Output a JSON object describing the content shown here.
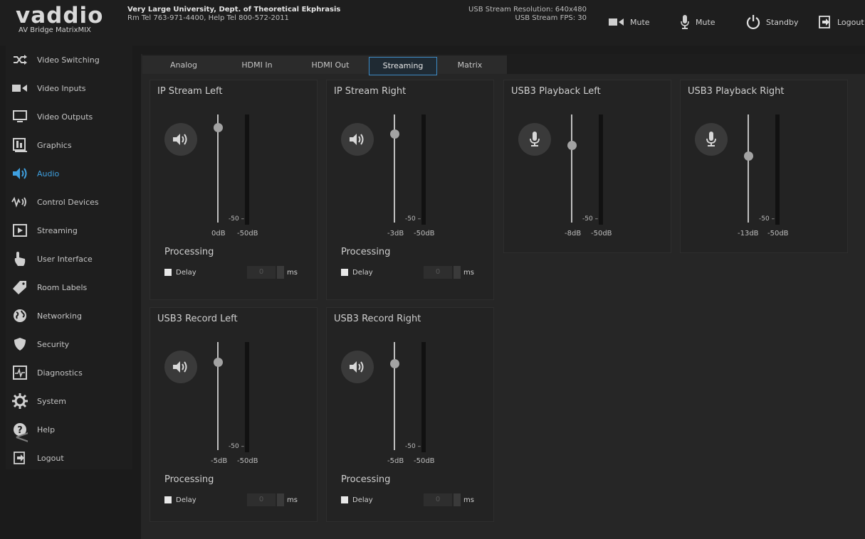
{
  "brand": {
    "logo": "vaddio",
    "product": "AV Bridge MatrixMIX"
  },
  "room": {
    "name": "Very Large University, Dept. of Theoretical Ekphrasis",
    "phones": "Rm Tel 763-971-4400, Help Tel 800-572-2011"
  },
  "usb_status": {
    "resolution": "USB Stream Resolution: 640x480",
    "fps": "USB Stream FPS: 30"
  },
  "top_actions": {
    "video_mute": "Mute",
    "audio_mute": "Mute",
    "standby": "Standby",
    "logout": "Logout"
  },
  "sidebar": {
    "items": [
      {
        "label": "Video Switching",
        "icon": "shuffle-icon"
      },
      {
        "label": "Video Inputs",
        "icon": "video-camera-icon"
      },
      {
        "label": "Video Outputs",
        "icon": "monitor-icon"
      },
      {
        "label": "Graphics",
        "icon": "graphics-icon"
      },
      {
        "label": "Audio",
        "icon": "speaker-icon",
        "active": true
      },
      {
        "label": "Control Devices",
        "icon": "control-devices-icon"
      },
      {
        "label": "Streaming",
        "icon": "play-icon"
      },
      {
        "label": "User Interface",
        "icon": "hand-pointer-icon"
      },
      {
        "label": "Room Labels",
        "icon": "tag-icon"
      },
      {
        "label": "Networking",
        "icon": "globe-icon"
      },
      {
        "label": "Security",
        "icon": "shield-icon"
      },
      {
        "label": "Diagnostics",
        "icon": "pulse-icon"
      },
      {
        "label": "System",
        "icon": "gear-icon"
      },
      {
        "label": "Help",
        "icon": "question-icon"
      },
      {
        "label": "Logout",
        "icon": "logout-icon"
      }
    ],
    "collapse": "<"
  },
  "tabs": [
    "Analog",
    "HDMI In",
    "HDMI Out",
    "Streaming",
    "Matrix"
  ],
  "active_tab": "Streaming",
  "panels": [
    {
      "title": "IP Stream Left",
      "icon": "speaker-icon",
      "level": "0dB",
      "floor": "-50dB",
      "scale": "-50",
      "has_processing": true,
      "processing": "Processing",
      "delay_label": "Delay",
      "delay_value": "0",
      "unit": "ms"
    },
    {
      "title": "IP Stream Right",
      "icon": "speaker-icon",
      "level": "-3dB",
      "floor": "-50dB",
      "scale": "-50",
      "has_processing": true,
      "processing": "Processing",
      "delay_label": "Delay",
      "delay_value": "0",
      "unit": "ms"
    },
    {
      "title": "USB3 Playback Left",
      "icon": "microphone-icon",
      "level": "-8dB",
      "floor": "-50dB",
      "scale": "-50",
      "has_processing": false
    },
    {
      "title": "USB3 Playback Right",
      "icon": "microphone-icon",
      "level": "-13dB",
      "floor": "-50dB",
      "scale": "-50",
      "has_processing": false
    },
    {
      "title": "USB3 Record Left",
      "icon": "speaker-icon",
      "level": "-5dB",
      "floor": "-50dB",
      "scale": "-50",
      "has_processing": true,
      "processing": "Processing",
      "delay_label": "Delay",
      "delay_value": "0",
      "unit": "ms"
    },
    {
      "title": "USB3 Record Right",
      "icon": "speaker-icon",
      "level": "-5dB",
      "floor": "-50dB",
      "scale": "-50",
      "has_processing": true,
      "processing": "Processing",
      "delay_label": "Delay",
      "delay_value": "0",
      "unit": "ms"
    }
  ],
  "colors": {
    "accent": "#3fa0e0",
    "background": "#1b1b1b",
    "panel": "#232323"
  }
}
